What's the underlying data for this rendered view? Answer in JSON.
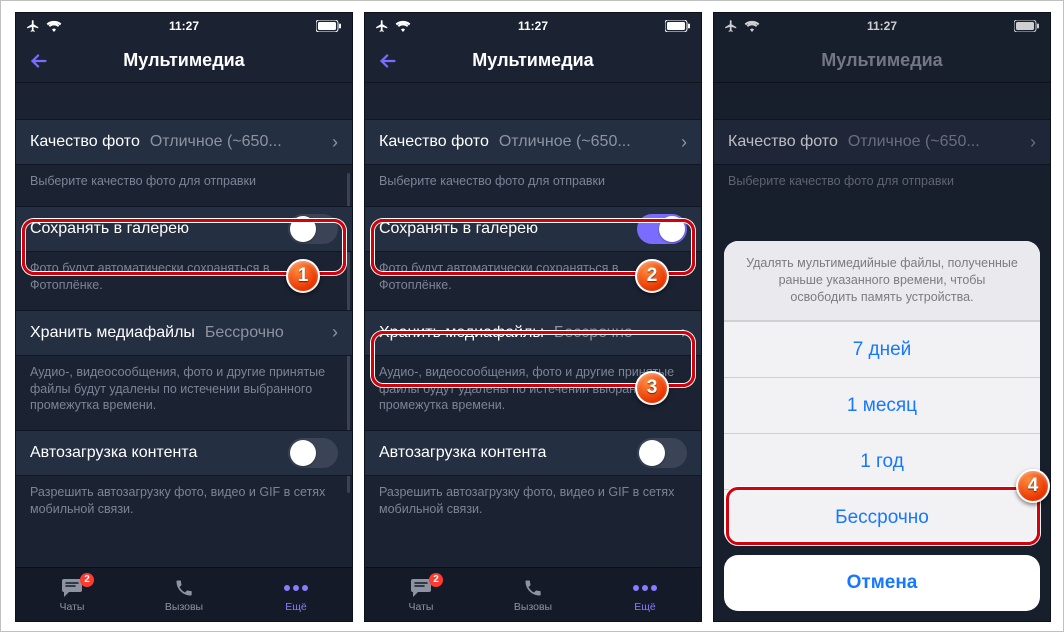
{
  "status": {
    "time": "11:27"
  },
  "nav": {
    "title": "Мультимедиа"
  },
  "cells": {
    "quality_label": "Качество фото",
    "quality_value": "Отличное (~650...",
    "quality_footer": "Выберите качество фото для отправки",
    "save_label": "Сохранять в галерею",
    "save_footer": "Фото будут автоматически сохраняться в Фотоплёнке.",
    "save_footer_clipped": "Фото будут автоматически сохраняться в Фотоплёнке.",
    "store_label": "Хранить медиафайлы",
    "store_value": "Бессрочно",
    "store_footer": "Аудио-, видеосообщения, фото и другие принятые файлы будут удалены по истечении выбранного промежутка времени.",
    "store_footer_clipped": "Аудио-, видеосообщения, фото и другие принятые файлы будут удалены по истечении выбранного промежутка времени.",
    "autoload_label": "Автозагрузка контента",
    "autoload_footer": "Разрешить автозагрузку фото, видео и GIF в сетях мобильной связи."
  },
  "tabs": {
    "chats": "Чаты",
    "calls": "Вызовы",
    "more": "Ещё",
    "chats_badge": "2"
  },
  "sheet": {
    "message": "Удалять мультимедийные файлы, полученные раньше указанного времени, чтобы освободить память устройства.",
    "opt1": "7 дней",
    "opt2": "1 месяц",
    "opt3": "1 год",
    "opt4": "Бессрочно",
    "cancel": "Отмена"
  },
  "badges": {
    "b1": "1",
    "b2": "2",
    "b3": "3",
    "b4": "4"
  }
}
